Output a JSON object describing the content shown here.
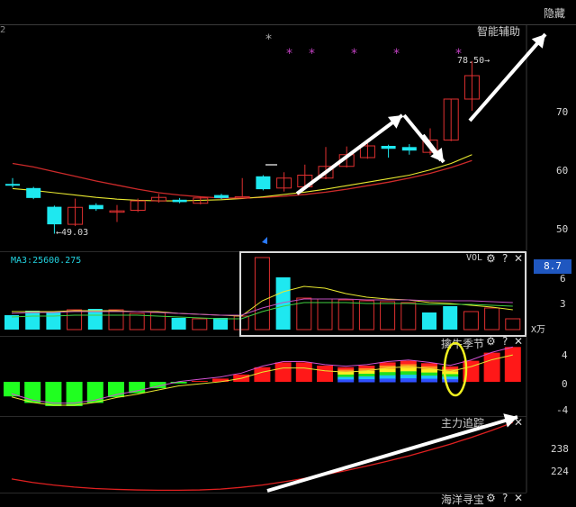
{
  "window": {
    "hide_label": "隐藏",
    "topleft_fragment": "2"
  },
  "main_chart": {
    "title": "智能辅助",
    "high_label": "78.50→",
    "low_label": "←49.03",
    "y_ticks": [
      "70",
      "60",
      "50"
    ],
    "colors": {
      "up": "#e03030",
      "down": "#1ee8f0",
      "ma_short": "#e8e830",
      "ma_long": "#cc2a2a"
    },
    "candles": [
      {
        "o": 57.5,
        "c": 57.2,
        "h": 58.5,
        "l": 56.9,
        "t": "down"
      },
      {
        "o": 56.8,
        "c": 55.1,
        "h": 57.0,
        "l": 54.9,
        "t": "down"
      },
      {
        "o": 53.6,
        "c": 50.6,
        "h": 53.8,
        "l": 49.0,
        "t": "down"
      },
      {
        "o": 50.6,
        "c": 53.5,
        "h": 55.0,
        "l": 50.3,
        "t": "up"
      },
      {
        "o": 53.9,
        "c": 53.2,
        "h": 54.2,
        "l": 52.9,
        "t": "down"
      },
      {
        "o": 52.8,
        "c": 52.9,
        "h": 53.9,
        "l": 51.0,
        "t": "up"
      },
      {
        "o": 53.0,
        "c": 54.6,
        "h": 55.0,
        "l": 52.7,
        "t": "up"
      },
      {
        "o": 54.6,
        "c": 55.2,
        "h": 55.8,
        "l": 54.3,
        "t": "up"
      },
      {
        "o": 54.8,
        "c": 54.4,
        "h": 55.1,
        "l": 54.2,
        "t": "down"
      },
      {
        "o": 54.2,
        "c": 55.1,
        "h": 55.4,
        "l": 54.0,
        "t": "up"
      },
      {
        "o": 55.6,
        "c": 55.1,
        "h": 55.8,
        "l": 54.9,
        "t": "down"
      },
      {
        "o": 55.3,
        "c": 55.3,
        "h": 58.5,
        "l": 55.3,
        "t": "up"
      },
      {
        "o": 58.8,
        "c": 56.6,
        "h": 59.0,
        "l": 56.4,
        "t": "down"
      },
      {
        "o": 56.8,
        "c": 58.5,
        "h": 59.5,
        "l": 56.2,
        "t": "up"
      },
      {
        "o": 57.0,
        "c": 59.0,
        "h": 60.8,
        "l": 56.8,
        "t": "up"
      },
      {
        "o": 58.5,
        "c": 60.5,
        "h": 63.8,
        "l": 58.3,
        "t": "up"
      },
      {
        "o": 60.5,
        "c": 62.5,
        "h": 63.9,
        "l": 60.3,
        "t": "up"
      },
      {
        "o": 62.0,
        "c": 64.0,
        "h": 64.5,
        "l": 61.8,
        "t": "up"
      },
      {
        "o": 64.0,
        "c": 63.5,
        "h": 64.2,
        "l": 62.0,
        "t": "down"
      },
      {
        "o": 63.8,
        "c": 63.2,
        "h": 64.3,
        "l": 62.5,
        "t": "down"
      },
      {
        "o": 62.9,
        "c": 65.0,
        "h": 67.0,
        "l": 62.5,
        "t": "up"
      },
      {
        "o": 65.0,
        "c": 72.0,
        "h": 72.0,
        "l": 64.8,
        "t": "up"
      },
      {
        "o": 72.0,
        "c": 76.0,
        "h": 78.5,
        "l": 70.0,
        "t": "up"
      }
    ],
    "ma_short": [
      56.7,
      56.4,
      56.0,
      55.6,
      55.2,
      54.9,
      54.7,
      54.6,
      54.6,
      54.7,
      54.8,
      55.0,
      55.3,
      55.7,
      56.1,
      56.6,
      57.2,
      57.8,
      58.4,
      59.0,
      59.9,
      61.0,
      62.5
    ],
    "ma_long": [
      61.0,
      60.4,
      59.6,
      58.8,
      58.0,
      57.3,
      56.6,
      56.0,
      55.6,
      55.3,
      55.1,
      55.1,
      55.2,
      55.4,
      55.7,
      56.1,
      56.6,
      57.2,
      57.8,
      58.5,
      59.3,
      60.3,
      61.5
    ],
    "star_marks": [
      "*",
      "*",
      "*",
      "*",
      "*",
      "*"
    ]
  },
  "vol_panel": {
    "ma_label": "MA3:25600.275",
    "title": "VOL",
    "value_box": "8.7",
    "y_ticks": [
      "6",
      "3"
    ],
    "unit": "X万",
    "volumes": [
      1.6,
      2.1,
      2.0,
      2.2,
      2.3,
      2.2,
      1.8,
      1.9,
      1.3,
      1.2,
      1.3,
      1.5,
      8.0,
      5.8,
      3.5,
      3.4,
      3.3,
      3.2,
      3.1,
      3.0,
      1.9,
      2.6,
      2.0,
      2.4,
      1.2
    ],
    "types": [
      "down",
      "down",
      "down",
      "up",
      "down",
      "up",
      "up",
      "up",
      "down",
      "up",
      "down",
      "up",
      "up",
      "down",
      "up",
      "up",
      "up",
      "up",
      "up",
      "up",
      "down",
      "down",
      "up",
      "up",
      "up"
    ],
    "ma_a": [
      2.0,
      2.0,
      2.0,
      2.1,
      2.1,
      2.1,
      2.0,
      2.0,
      1.8,
      1.7,
      1.6,
      1.5,
      3.2,
      4.2,
      4.8,
      4.6,
      4.0,
      3.6,
      3.4,
      3.3,
      3.0,
      2.9,
      2.7,
      2.5,
      2.2
    ],
    "ma_b": [
      1.8,
      1.9,
      1.9,
      2.0,
      2.0,
      2.0,
      2.0,
      1.9,
      1.8,
      1.7,
      1.6,
      1.6,
      2.4,
      3.0,
      3.4,
      3.4,
      3.4,
      3.3,
      3.3,
      3.3,
      3.2,
      3.2,
      3.2,
      3.1,
      3.0
    ]
  },
  "season_panel": {
    "title": "擒牛季节",
    "y_ticks": [
      "4",
      "0",
      "-4"
    ],
    "bars": [
      -1.8,
      -2.6,
      -3.0,
      -3.0,
      -2.6,
      -1.9,
      -1.4,
      -0.8,
      -0.2,
      0.1,
      0.4,
      0.9,
      1.8,
      2.4,
      2.4,
      2.0,
      1.8,
      2.0,
      2.4,
      2.6,
      2.3,
      1.9,
      2.6,
      3.6,
      4.3
    ]
  },
  "chase_panel": {
    "title": "主力追踪",
    "y_ticks": [
      "238",
      "224"
    ],
    "line": [
      218.4,
      217.2,
      216.3,
      215.6,
      215.1,
      214.8,
      214.6,
      214.5,
      214.5,
      214.6,
      214.9,
      215.5,
      216.3,
      217.4,
      218.6,
      219.9,
      221.3,
      222.9,
      224.6,
      226.4,
      228.4,
      230.5,
      232.8,
      235.3,
      238.0
    ]
  },
  "bottom_panel": {
    "title": "海洋寻宝"
  },
  "icon_set": {
    "gear": "⚙",
    "help": "?",
    "close": "✕"
  }
}
